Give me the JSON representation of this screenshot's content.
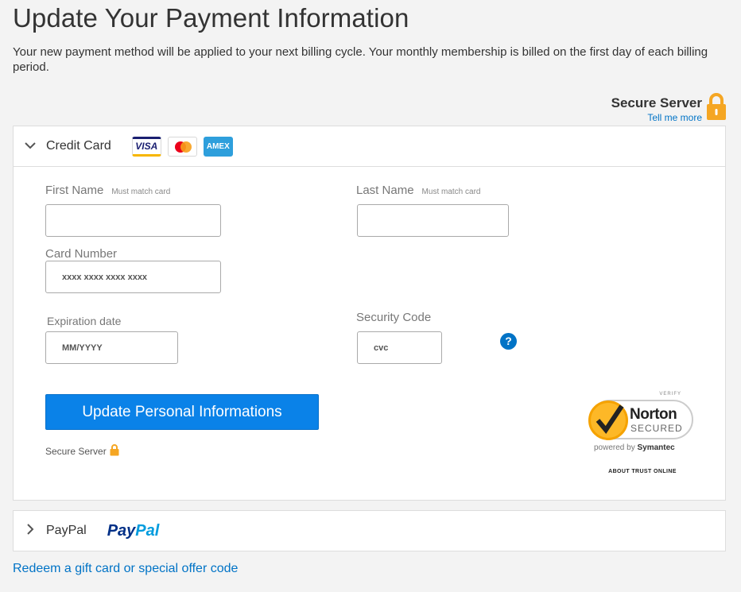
{
  "header": {
    "title": "Update Your Payment Information",
    "subtitle": "Your new payment method will be applied to your next billing cycle. Your monthly membership is billed on the first day of each billing period."
  },
  "secure_server": {
    "title": "Secure Server",
    "tell_more": "Tell me more"
  },
  "credit_card": {
    "label": "Credit Card",
    "cards": {
      "visa": "VISA",
      "mastercard": "MasterCard",
      "amex": "AMEX"
    },
    "first_name": {
      "label": "First Name",
      "hint": "Must match card",
      "value": ""
    },
    "last_name": {
      "label": "Last Name",
      "hint": "Must match card",
      "value": ""
    },
    "card_number": {
      "label": "Card Number",
      "placeholder": "xxxx xxxx xxxx xxxx"
    },
    "expiration": {
      "label": "Expiration date",
      "placeholder": "MM/YYYY"
    },
    "security_code": {
      "label": "Security Code",
      "placeholder": "cvc",
      "help": "?"
    },
    "submit_label": "Update Personal Informations",
    "secure_small": "Secure Server",
    "norton": {
      "verify": "VERIFY",
      "name": "Norton",
      "secured": "SECURED",
      "powered_prefix": "powered by",
      "powered_brand": "Symantec",
      "about": "ABOUT TRUST ONLINE"
    }
  },
  "paypal": {
    "label": "PayPal",
    "logo_a": "Pay",
    "logo_b": "Pal"
  },
  "footer": {
    "redeem": "Redeem a gift card or special offer code"
  },
  "colors": {
    "accent": "#0a82e8",
    "link": "#0073c6",
    "lock": "#f5a623"
  },
  "icons": {
    "lock": "lock-icon",
    "chevron_open": "chevron-down-icon",
    "chevron_closed": "chevron-right-icon",
    "help": "question-icon"
  }
}
